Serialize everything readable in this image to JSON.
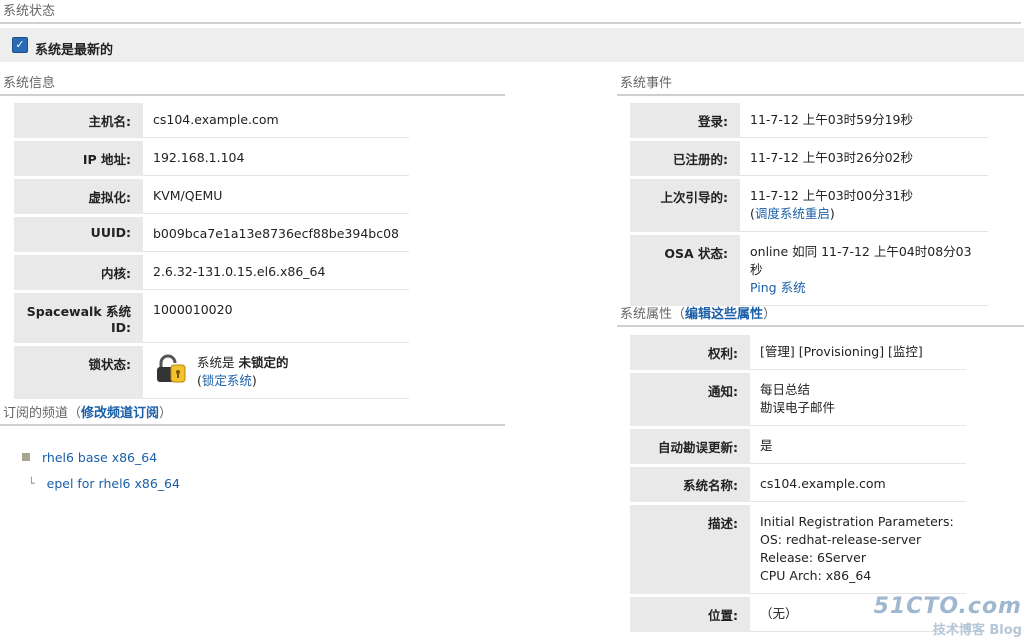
{
  "header": {
    "title": "系统状态"
  },
  "status": {
    "text": "系统是最新的"
  },
  "system_info": {
    "title": "系统信息",
    "rows": [
      {
        "key": "主机名:",
        "value": "cs104.example.com"
      },
      {
        "key": "IP 地址:",
        "value": "192.168.1.104"
      },
      {
        "key": "虚拟化:",
        "value": "KVM/QEMU"
      },
      {
        "key": "UUID:",
        "value": "b009bca7e1a13e8736ecf88be394bc08"
      },
      {
        "key": "内核:",
        "value": "2.6.32-131.0.15.el6.x86_64"
      },
      {
        "key": "Spacewalk 系统 ID:",
        "value": "1000010020"
      }
    ],
    "lock": {
      "key": "锁状态:",
      "prefix": "系统是 ",
      "state": "未锁定的",
      "link": "锁定系统"
    }
  },
  "channels": {
    "title": "订阅的频道（",
    "link": "修改频道订阅",
    "title_end": "）",
    "items": [
      "rhel6 base x86_64",
      "epel for rhel6 x86_64"
    ],
    "child_marker": "└"
  },
  "events": {
    "title": "系统事件",
    "login": {
      "key": "登录:",
      "value": "11-7-12 上午03时59分19秒"
    },
    "registered": {
      "key": "已注册的:",
      "value": "11-7-12 上午03时26分02秒"
    },
    "boot": {
      "key": "上次引导的:",
      "value": "11-7-12 上午03时00分31秒",
      "link": "调度系统重启"
    },
    "osa": {
      "key": "OSA 状态:",
      "value": "online 如同 11-7-12 上午04时08分03秒",
      "link": "Ping 系统"
    }
  },
  "properties": {
    "title": "系统属性（",
    "link": "编辑这些属性",
    "title_end": "）",
    "entitlements": {
      "key": "权利:",
      "value": "[管理] [Provisioning] [监控]"
    },
    "notify": {
      "key": "通知:",
      "line1": "每日总结",
      "line2": "勘误电子邮件"
    },
    "auto_update": {
      "key": "自动勘误更新:",
      "value": "是"
    },
    "name": {
      "key": "系统名称:",
      "value": "cs104.example.com"
    },
    "description": {
      "key": "描述:",
      "lines": [
        "Initial Registration Parameters:",
        "OS: redhat-release-server",
        "Release: 6Server",
        "CPU Arch: x86_64"
      ]
    },
    "location": {
      "key": "位置:",
      "value": "（无）"
    }
  },
  "watermark": {
    "big": "51CTO.com",
    "small": "技术博客 Blog"
  }
}
